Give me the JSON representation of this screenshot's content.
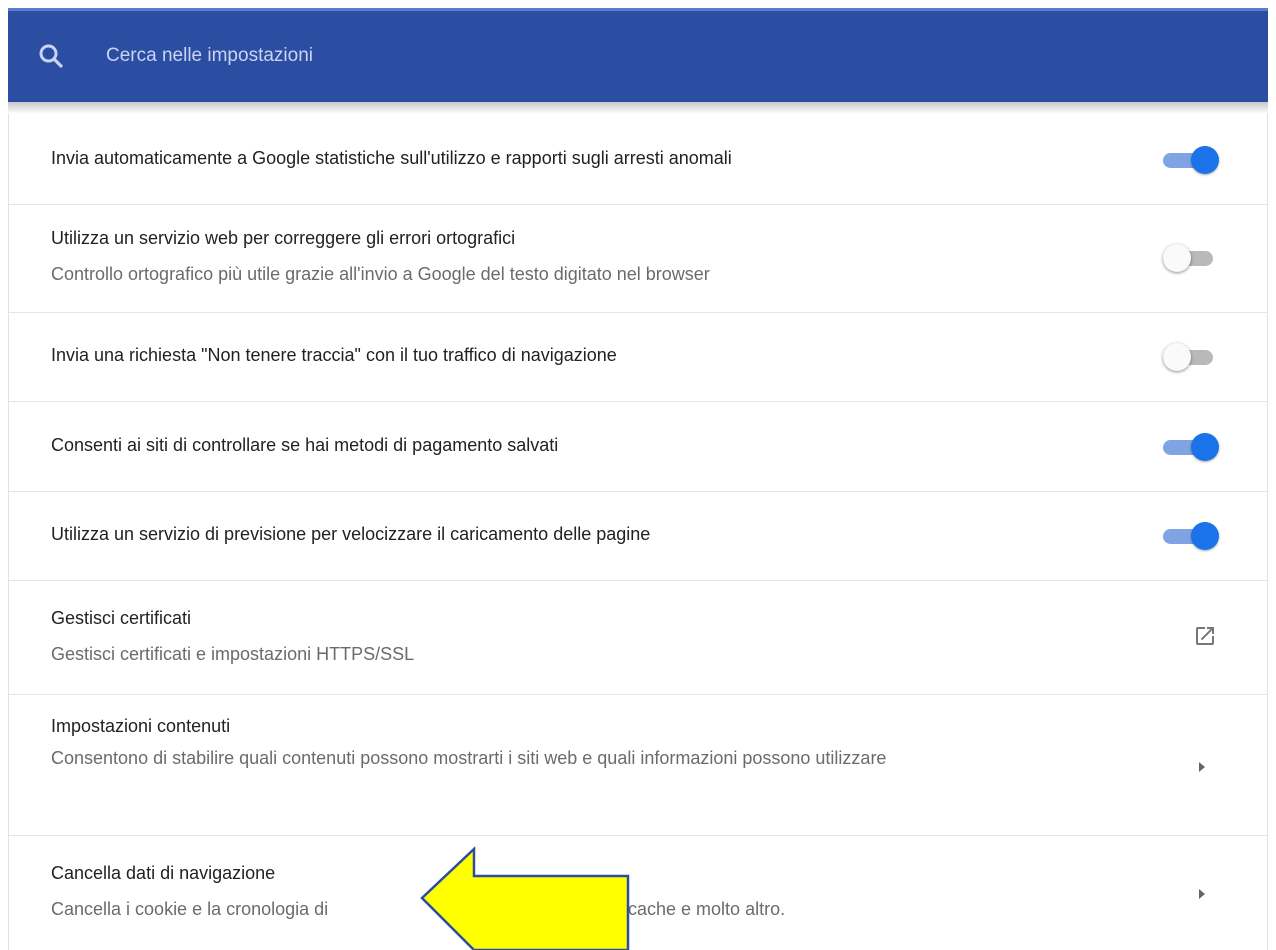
{
  "search": {
    "placeholder": "Cerca nelle impostazioni",
    "icon": "search-icon"
  },
  "colors": {
    "header_bg": "#2b4ea3",
    "toggle_on": "#1a73e8",
    "arrow_fill": "#ffff00",
    "arrow_stroke": "#2b4ea3"
  },
  "settings": [
    {
      "title": "Invia automaticamente a Google statistiche sull'utilizzo e rapporti sugli arresti anomali",
      "control": "toggle",
      "enabled": true
    },
    {
      "title": "Utilizza un servizio web per correggere gli errori ortografici",
      "subtitle": "Controllo ortografico più utile grazie all'invio a Google del testo digitato nel browser",
      "control": "toggle",
      "enabled": false
    },
    {
      "title": "Invia una richiesta \"Non tenere traccia\" con il tuo traffico di navigazione",
      "control": "toggle",
      "enabled": false
    },
    {
      "title": "Consenti ai siti di controllare se hai metodi di pagamento salvati",
      "control": "toggle",
      "enabled": true
    },
    {
      "title": "Utilizza un servizio di previsione per velocizzare il caricamento delle pagine",
      "control": "toggle",
      "enabled": true
    },
    {
      "title": "Gestisci certificati",
      "subtitle": "Gestisci certificati e impostazioni HTTPS/SSL",
      "control": "external-link-icon"
    },
    {
      "title": "Impostazioni contenuti",
      "subtitle": "Consentono di stabilire quali contenuti possono mostrarti i siti web e quali informazioni possono utilizzare",
      "control": "chevron-right-icon"
    },
    {
      "title": "Cancella dati di navigazione",
      "subtitle": "Cancella i cookie e la cronologia di navigazione, svuota la cache e molto altro.",
      "control": "chevron-right-icon",
      "subtitle_visible_start": "Cancella i cookie e la cronologia di",
      "subtitle_visible_end": "la cache e molto altro."
    }
  ]
}
